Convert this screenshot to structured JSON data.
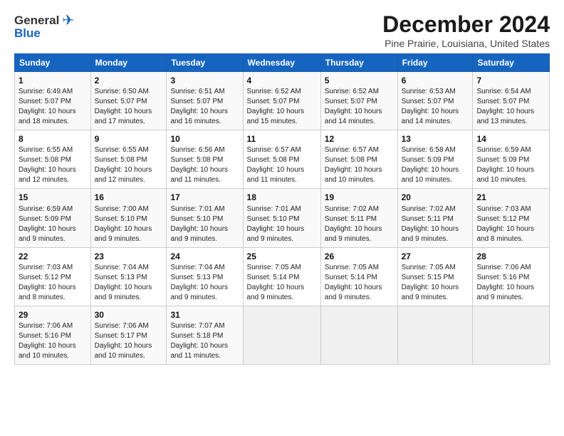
{
  "logo": {
    "general": "General",
    "blue": "Blue"
  },
  "title": "December 2024",
  "location": "Pine Prairie, Louisiana, United States",
  "days_of_week": [
    "Sunday",
    "Monday",
    "Tuesday",
    "Wednesday",
    "Thursday",
    "Friday",
    "Saturday"
  ],
  "weeks": [
    [
      {
        "day": "1",
        "sunrise": "6:49 AM",
        "sunset": "5:07 PM",
        "daylight": "10 hours and 18 minutes."
      },
      {
        "day": "2",
        "sunrise": "6:50 AM",
        "sunset": "5:07 PM",
        "daylight": "10 hours and 17 minutes."
      },
      {
        "day": "3",
        "sunrise": "6:51 AM",
        "sunset": "5:07 PM",
        "daylight": "10 hours and 16 minutes."
      },
      {
        "day": "4",
        "sunrise": "6:52 AM",
        "sunset": "5:07 PM",
        "daylight": "10 hours and 15 minutes."
      },
      {
        "day": "5",
        "sunrise": "6:52 AM",
        "sunset": "5:07 PM",
        "daylight": "10 hours and 14 minutes."
      },
      {
        "day": "6",
        "sunrise": "6:53 AM",
        "sunset": "5:07 PM",
        "daylight": "10 hours and 14 minutes."
      },
      {
        "day": "7",
        "sunrise": "6:54 AM",
        "sunset": "5:07 PM",
        "daylight": "10 hours and 13 minutes."
      }
    ],
    [
      {
        "day": "8",
        "sunrise": "6:55 AM",
        "sunset": "5:08 PM",
        "daylight": "10 hours and 12 minutes."
      },
      {
        "day": "9",
        "sunrise": "6:55 AM",
        "sunset": "5:08 PM",
        "daylight": "10 hours and 12 minutes."
      },
      {
        "day": "10",
        "sunrise": "6:56 AM",
        "sunset": "5:08 PM",
        "daylight": "10 hours and 11 minutes."
      },
      {
        "day": "11",
        "sunrise": "6:57 AM",
        "sunset": "5:08 PM",
        "daylight": "10 hours and 11 minutes."
      },
      {
        "day": "12",
        "sunrise": "6:57 AM",
        "sunset": "5:08 PM",
        "daylight": "10 hours and 10 minutes."
      },
      {
        "day": "13",
        "sunrise": "6:58 AM",
        "sunset": "5:09 PM",
        "daylight": "10 hours and 10 minutes."
      },
      {
        "day": "14",
        "sunrise": "6:59 AM",
        "sunset": "5:09 PM",
        "daylight": "10 hours and 10 minutes."
      }
    ],
    [
      {
        "day": "15",
        "sunrise": "6:59 AM",
        "sunset": "5:09 PM",
        "daylight": "10 hours and 9 minutes."
      },
      {
        "day": "16",
        "sunrise": "7:00 AM",
        "sunset": "5:10 PM",
        "daylight": "10 hours and 9 minutes."
      },
      {
        "day": "17",
        "sunrise": "7:01 AM",
        "sunset": "5:10 PM",
        "daylight": "10 hours and 9 minutes."
      },
      {
        "day": "18",
        "sunrise": "7:01 AM",
        "sunset": "5:10 PM",
        "daylight": "10 hours and 9 minutes."
      },
      {
        "day": "19",
        "sunrise": "7:02 AM",
        "sunset": "5:11 PM",
        "daylight": "10 hours and 9 minutes."
      },
      {
        "day": "20",
        "sunrise": "7:02 AM",
        "sunset": "5:11 PM",
        "daylight": "10 hours and 9 minutes."
      },
      {
        "day": "21",
        "sunrise": "7:03 AM",
        "sunset": "5:12 PM",
        "daylight": "10 hours and 8 minutes."
      }
    ],
    [
      {
        "day": "22",
        "sunrise": "7:03 AM",
        "sunset": "5:12 PM",
        "daylight": "10 hours and 8 minutes."
      },
      {
        "day": "23",
        "sunrise": "7:04 AM",
        "sunset": "5:13 PM",
        "daylight": "10 hours and 9 minutes."
      },
      {
        "day": "24",
        "sunrise": "7:04 AM",
        "sunset": "5:13 PM",
        "daylight": "10 hours and 9 minutes."
      },
      {
        "day": "25",
        "sunrise": "7:05 AM",
        "sunset": "5:14 PM",
        "daylight": "10 hours and 9 minutes."
      },
      {
        "day": "26",
        "sunrise": "7:05 AM",
        "sunset": "5:14 PM",
        "daylight": "10 hours and 9 minutes."
      },
      {
        "day": "27",
        "sunrise": "7:05 AM",
        "sunset": "5:15 PM",
        "daylight": "10 hours and 9 minutes."
      },
      {
        "day": "28",
        "sunrise": "7:06 AM",
        "sunset": "5:16 PM",
        "daylight": "10 hours and 9 minutes."
      }
    ],
    [
      {
        "day": "29",
        "sunrise": "7:06 AM",
        "sunset": "5:16 PM",
        "daylight": "10 hours and 10 minutes."
      },
      {
        "day": "30",
        "sunrise": "7:06 AM",
        "sunset": "5:17 PM",
        "daylight": "10 hours and 10 minutes."
      },
      {
        "day": "31",
        "sunrise": "7:07 AM",
        "sunset": "5:18 PM",
        "daylight": "10 hours and 11 minutes."
      },
      null,
      null,
      null,
      null
    ]
  ],
  "labels": {
    "sunrise": "Sunrise:",
    "sunset": "Sunset:",
    "daylight": "Daylight:"
  }
}
